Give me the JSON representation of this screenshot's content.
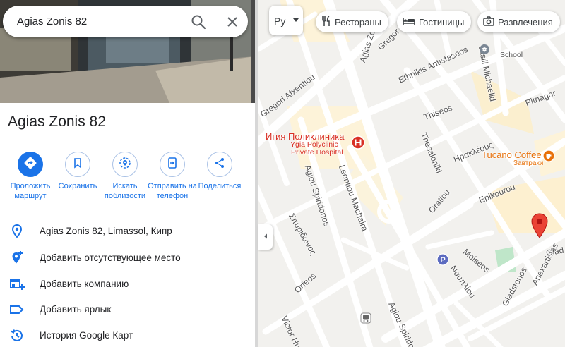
{
  "search": {
    "value": "Agias Zonis 82",
    "search_icon": "search-icon",
    "close_icon": "close-icon"
  },
  "place": {
    "title": "Agias Zonis 82"
  },
  "actions": [
    {
      "label": "Проложить маршрут",
      "icon": "directions-icon"
    },
    {
      "label": "Сохранить",
      "icon": "bookmark-icon"
    },
    {
      "label": "Искать поблизости",
      "icon": "nearby-icon"
    },
    {
      "label": "Отправить на телефон",
      "icon": "send-to-phone-icon"
    },
    {
      "label": "Поделиться",
      "icon": "share-icon"
    }
  ],
  "details": [
    {
      "text": "Agias Zonis 82, Limassol, Кипр",
      "icon": "location-pin-icon"
    },
    {
      "text": "Добавить отсутствующее место",
      "icon": "add-place-icon"
    },
    {
      "text": "Добавить компанию",
      "icon": "add-business-icon"
    },
    {
      "text": "Добавить ярлык",
      "icon": "label-icon"
    },
    {
      "text": "История Google Карт",
      "icon": "history-icon"
    }
  ],
  "map": {
    "layer_label": "Ру",
    "chips": [
      {
        "label": "Рестораны",
        "icon": "restaurant-icon"
      },
      {
        "label": "Гостиницы",
        "icon": "hotel-icon"
      },
      {
        "label": "Развлечения",
        "icon": "camera-icon"
      }
    ],
    "streets": {
      "s1": "Agias Zonis",
      "s2": "Gregor",
      "s3": "Ethnikis Antistaseos",
      "s4": "Vasili Michaelid",
      "s5": "Pithagor",
      "s6": "Gregori Afxentiou",
      "s7": "Thiseos",
      "s8": "Thesaloniki",
      "s9": "Ηρακλέους",
      "s10": "Agiou Spiridonos",
      "s11": "Leontiou Machaira",
      "s12": "Oratiou",
      "s13": "Epikourou",
      "s14": "Σπυρίδωνος",
      "s15": "Orfeos",
      "s16": "Moiseos",
      "s17": "Ναυπλίου",
      "s18": "Gladstonos",
      "s19": "Anexartisias",
      "s20": "Glad",
      "s21": "Victor Hugo",
      "s22": "Agiou Spiridonos"
    },
    "poi": {
      "clinic_ru": "Игия Поликлиника",
      "clinic_en1": "Ygia Polyclinic",
      "clinic_en2": "Private Hospital",
      "coffee": "Tucano Coffee",
      "coffee_sub": "Завтраки",
      "school": "School"
    },
    "colors": {
      "road": "#ffffff",
      "block": "#f3f2ef",
      "highlight_block": "#fdf3d9",
      "marker": "#ea4335",
      "accent": "#1a73e8"
    }
  }
}
